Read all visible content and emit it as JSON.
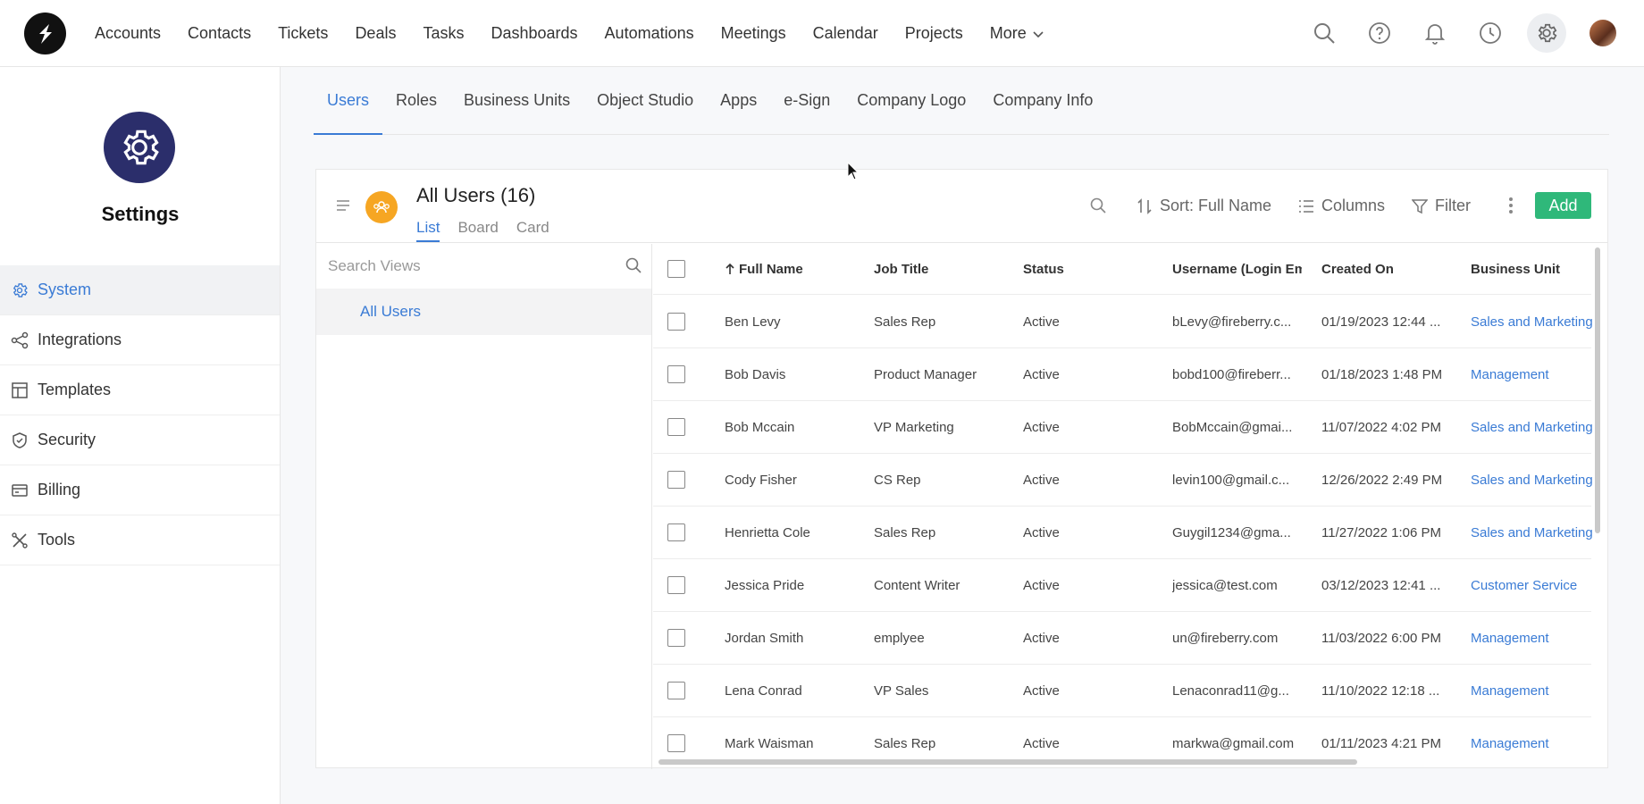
{
  "nav": {
    "items": [
      "Accounts",
      "Contacts",
      "Tickets",
      "Deals",
      "Tasks",
      "Dashboards",
      "Automations",
      "Meetings",
      "Calendar",
      "Projects"
    ],
    "more_label": "More"
  },
  "sidebar": {
    "title": "Settings",
    "items": [
      {
        "label": "System",
        "icon": "gear-icon",
        "active": true
      },
      {
        "label": "Integrations",
        "icon": "share-icon"
      },
      {
        "label": "Templates",
        "icon": "template-icon"
      },
      {
        "label": "Security",
        "icon": "shield-icon"
      },
      {
        "label": "Billing",
        "icon": "card-icon"
      },
      {
        "label": "Tools",
        "icon": "tools-icon"
      }
    ]
  },
  "tabs": [
    "Users",
    "Roles",
    "Business Units",
    "Object Studio",
    "Apps",
    "e-Sign",
    "Company Logo",
    "Company Info"
  ],
  "view": {
    "title": "All Users",
    "count": "(16)",
    "tabs": [
      "List",
      "Board",
      "Card"
    ],
    "sort_label": "Sort: Full Name",
    "columns_label": "Columns",
    "filter_label": "Filter",
    "add_label": "Add"
  },
  "views_panel": {
    "search_placeholder": "Search Views",
    "items": [
      "All Users"
    ]
  },
  "table": {
    "headers": [
      "Full Name",
      "Job Title",
      "Status",
      "Username (Login Em",
      "Created On",
      "Business Unit"
    ],
    "rows": [
      [
        "Ben Levy",
        "Sales Rep",
        "Active",
        "bLevy@fireberry.c...",
        "01/19/2023 12:44 ...",
        "Sales and Marketing"
      ],
      [
        "Bob Davis",
        "Product Manager",
        "Active",
        "bobd100@fireberr...",
        "01/18/2023 1:48 PM",
        "Management"
      ],
      [
        "Bob Mccain",
        "VP Marketing",
        "Active",
        "BobMccain@gmai...",
        "11/07/2022 4:02 PM",
        "Sales and Marketing"
      ],
      [
        "Cody Fisher",
        "CS Rep",
        "Active",
        "levin100@gmail.c...",
        "12/26/2022 2:49 PM",
        "Sales and Marketing"
      ],
      [
        "Henrietta Cole",
        "Sales Rep",
        "Active",
        "Guygil1234@gma...",
        "11/27/2022 1:06 PM",
        "Sales and Marketing"
      ],
      [
        "Jessica Pride",
        "Content Writer",
        "Active",
        "jessica@test.com",
        "03/12/2023 12:41 ...",
        "Customer Service"
      ],
      [
        "Jordan Smith",
        "emplyee",
        "Active",
        "un@fireberry.com",
        "11/03/2022 6:00 PM",
        "Management"
      ],
      [
        "Lena Conrad",
        "VP Sales",
        "Active",
        "Lenaconrad11@g...",
        "11/10/2022 12:18 ...",
        "Management"
      ],
      [
        "Mark Waisman",
        "Sales Rep",
        "Active",
        "markwa@gmail.com",
        "01/11/2023 4:21 PM",
        "Management"
      ]
    ]
  },
  "colors": {
    "accent": "#3a7bd5",
    "settings_badge": "#2b2e6b",
    "users_badge": "#f6a623",
    "add_button": "#2fb87a"
  }
}
